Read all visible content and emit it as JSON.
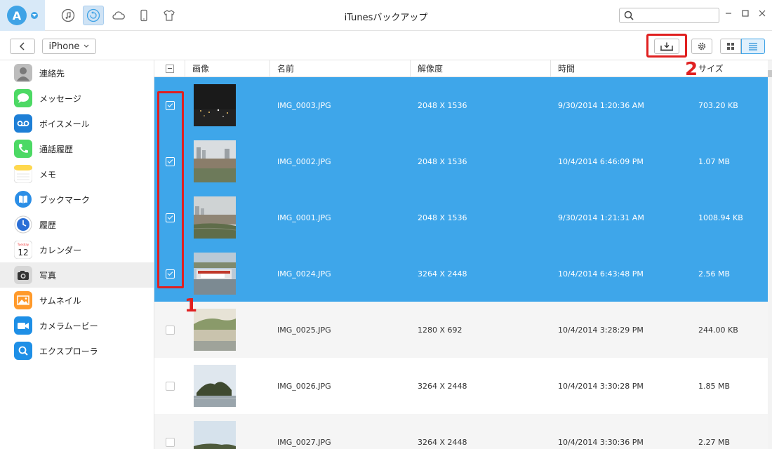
{
  "window": {
    "title": "iTunesバックアップ"
  },
  "nav": {
    "icons": [
      "music-icon",
      "backup-icon",
      "cloud-icon",
      "phone-icon",
      "tshirt-icon"
    ],
    "active_index": 1
  },
  "search": {
    "placeholder": "",
    "value": ""
  },
  "toolbar": {
    "device": "iPhone"
  },
  "sidebar": {
    "items": [
      {
        "label": "連絡先",
        "icon": "contacts-icon",
        "color": "#9a9a9a"
      },
      {
        "label": "メッセージ",
        "icon": "messages-icon",
        "color": "#4cd964"
      },
      {
        "label": "ボイスメール",
        "icon": "voicemail-icon",
        "color": "#1e7fd6"
      },
      {
        "label": "通話履歴",
        "icon": "phone-call-icon",
        "color": "#4cd964"
      },
      {
        "label": "メモ",
        "icon": "notes-icon",
        "color": "#ffd84d"
      },
      {
        "label": "ブックマーク",
        "icon": "bookmark-icon",
        "color": "#2b8ee6"
      },
      {
        "label": "履歴",
        "icon": "history-icon",
        "color": "#2b6fd6"
      },
      {
        "label": "カレンダー",
        "icon": "calendar-icon",
        "color": "#ffffff"
      },
      {
        "label": "写真",
        "icon": "camera-icon",
        "color": "#555555"
      },
      {
        "label": "サムネイル",
        "icon": "thumbnail-icon",
        "color": "#ff9a2b"
      },
      {
        "label": "カメラムービー",
        "icon": "video-camera-icon",
        "color": "#1e8fe6"
      },
      {
        "label": "エクスプローラ",
        "icon": "explorer-icon",
        "color": "#1e8fe6"
      }
    ],
    "active_index": 8,
    "calendar_day": "12",
    "calendar_weekday": "Tuesday"
  },
  "table": {
    "headers": {
      "image": "画像",
      "name": "名前",
      "resolution": "解像度",
      "time": "時間",
      "size": "サイズ"
    },
    "rows": [
      {
        "name": "IMG_0003.JPG",
        "resolution": "2048 X 1536",
        "time": "9/30/2014 1:20:36 AM",
        "size": "703.20 KB",
        "selected": true,
        "thumb": "night"
      },
      {
        "name": "IMG_0002.JPG",
        "resolution": "2048 X 1536",
        "time": "10/4/2014 6:46:09 PM",
        "size": "1.07 MB",
        "selected": true,
        "thumb": "city"
      },
      {
        "name": "IMG_0001.JPG",
        "resolution": "2048 X 1536",
        "time": "9/30/2014 1:21:31 AM",
        "size": "1008.94 KB",
        "selected": true,
        "thumb": "city2"
      },
      {
        "name": "IMG_0024.JPG",
        "resolution": "3264 X 2448",
        "time": "10/4/2014 6:43:48 PM",
        "size": "2.56 MB",
        "selected": true,
        "thumb": "boat"
      },
      {
        "name": "IMG_0025.JPG",
        "resolution": "1280 X 692",
        "time": "10/4/2014 3:28:29 PM",
        "size": "244.00 KB",
        "selected": false,
        "thumb": "river"
      },
      {
        "name": "IMG_0026.JPG",
        "resolution": "3264 X 2448",
        "time": "10/4/2014 3:30:28 PM",
        "size": "1.85 MB",
        "selected": false,
        "thumb": "island"
      },
      {
        "name": "IMG_0027.JPG",
        "resolution": "3264 X 2448",
        "time": "10/4/2014 3:30:36 PM",
        "size": "2.27 MB",
        "selected": false,
        "thumb": "shore"
      }
    ]
  },
  "annotations": {
    "callout_1": "1",
    "callout_2": "2"
  },
  "colors": {
    "selection": "#3ea6ea",
    "highlight": "#e02020",
    "accent": "#3fa3e6"
  }
}
